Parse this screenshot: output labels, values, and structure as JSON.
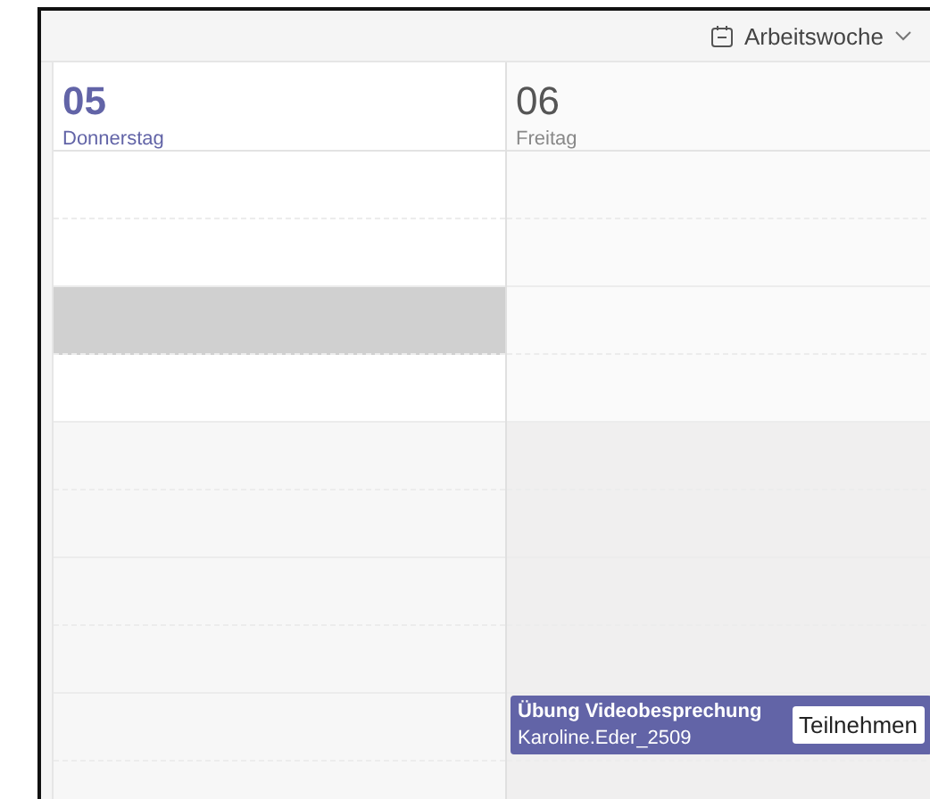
{
  "toolbar": {
    "view_switcher": {
      "label": "Arbeitswoche"
    }
  },
  "days": [
    {
      "number": "05",
      "weekday": "Donnerstag",
      "selected": true,
      "slots": [
        {
          "selected": false
        },
        {
          "selected": false
        },
        {
          "selected": true
        },
        {
          "selected": false
        },
        {
          "selected": false
        },
        {
          "selected": false
        },
        {
          "selected": false
        },
        {
          "selected": false
        },
        {
          "selected": false
        },
        {
          "selected": false
        }
      ]
    },
    {
      "number": "06",
      "weekday": "Freitag",
      "selected": false,
      "slots": [
        {
          "selected": false
        },
        {
          "selected": false
        },
        {
          "selected": false
        },
        {
          "selected": false
        },
        {
          "selected": false
        },
        {
          "selected": false
        },
        {
          "selected": false
        },
        {
          "selected": false
        },
        {
          "selected": false,
          "event": {
            "title": "Übung Videobesprechung",
            "organizer": "Karoline.Eder_2509",
            "join_button": "Teilnehmen"
          }
        },
        {
          "selected": false
        }
      ]
    }
  ]
}
